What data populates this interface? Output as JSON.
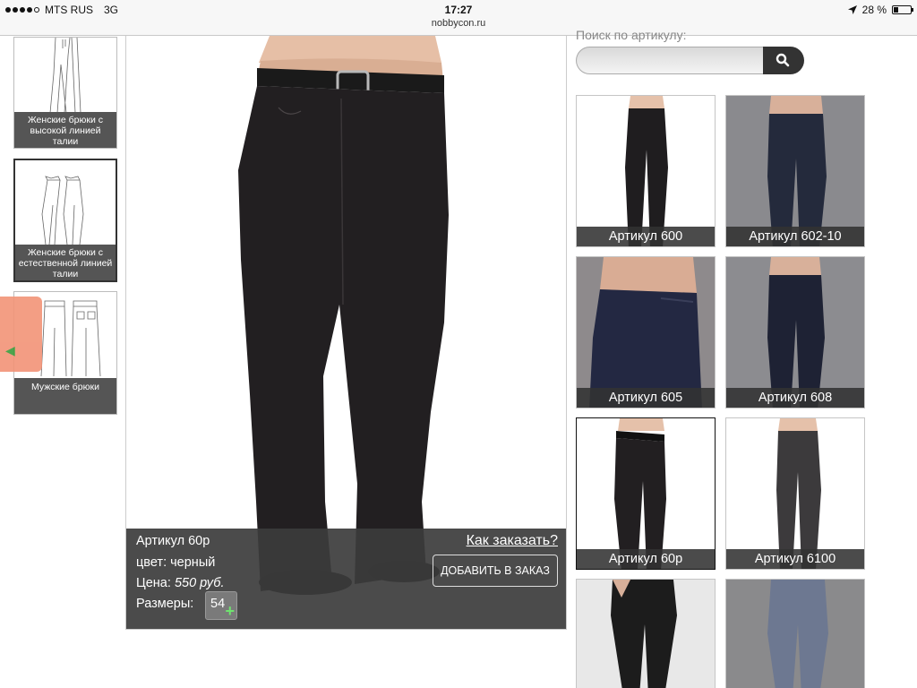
{
  "status_bar": {
    "carrier": "MTS RUS",
    "network": "3G",
    "time": "17:27",
    "url": "nobbycon.ru",
    "battery": "28 %",
    "battery_level": 0.28
  },
  "categories": [
    {
      "label": "Женские брюки с высокой линией талии",
      "active": false
    },
    {
      "label": "Женские брюки с естественной линией талии",
      "active": true
    },
    {
      "label": "Мужские брюки",
      "active": false
    }
  ],
  "product": {
    "article": "Артикул 60р",
    "color": "цвет: черный",
    "price_label": "Цена:",
    "price": "550 руб.",
    "sizes_label": "Размеры:",
    "size": "54",
    "how_to_order": "Как заказать?",
    "add_to_order": "ДОБАВИТЬ В ЗАКАЗ"
  },
  "search": {
    "label": "Поиск по артикулу:",
    "value": "",
    "button_icon": "search-icon"
  },
  "grid": [
    {
      "caption": "Артикул 600",
      "selected": false
    },
    {
      "caption": "Артикул 602-10",
      "selected": false
    },
    {
      "caption": "Артикул 605",
      "selected": false
    },
    {
      "caption": "Артикул 608",
      "selected": false
    },
    {
      "caption": "Артикул 60р",
      "selected": true
    },
    {
      "caption": "Артикул 6100",
      "selected": false
    },
    {
      "caption": "",
      "selected": false
    },
    {
      "caption": "",
      "selected": false
    }
  ],
  "colors": {
    "accent_tab": "#f29377",
    "caption_bg": "#323232",
    "plus_green": "#6fe36f"
  }
}
